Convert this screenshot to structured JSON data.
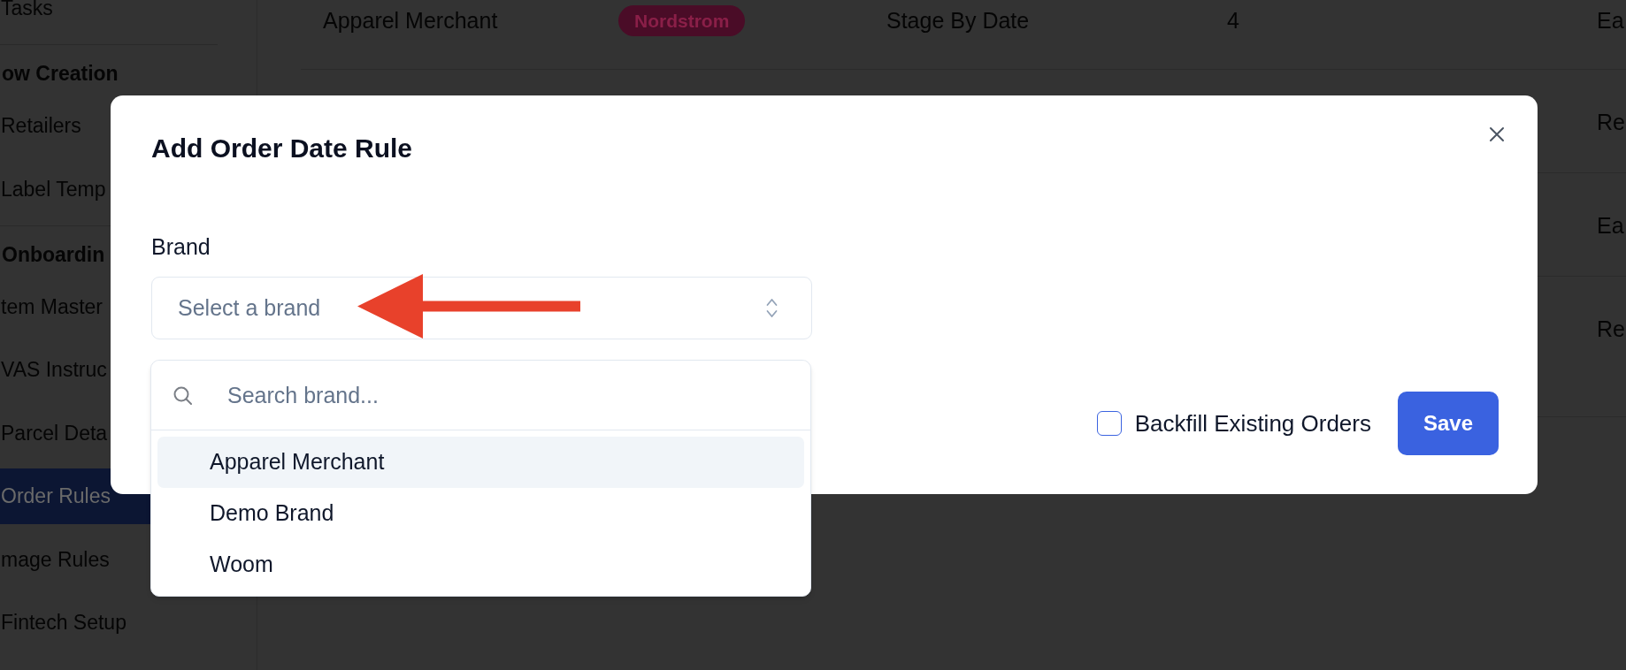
{
  "sidebar": {
    "sections": [
      {
        "items": [
          {
            "label": "Tasks",
            "selected": false
          }
        ]
      },
      {
        "title": "ow Creation",
        "items": [
          {
            "label": "Retailers",
            "selected": false
          },
          {
            "label": "Label Temp",
            "selected": false
          }
        ]
      },
      {
        "title": "Onboardin",
        "items": [
          {
            "label": "tem Master",
            "selected": false
          },
          {
            "label": "VAS Instruc",
            "selected": false
          },
          {
            "label": "Parcel Deta",
            "selected": false
          },
          {
            "label": "Order Rules",
            "selected": true
          },
          {
            "label": "mage Rules",
            "selected": false
          },
          {
            "label": "Fintech Setup",
            "selected": false
          }
        ]
      }
    ]
  },
  "table": {
    "rows": [
      {
        "column_1": "Apparel Merchant",
        "column_2": "Nordstrom",
        "column_3": "Stage By Date",
        "column_4": "4",
        "column_5": "Ea"
      },
      {
        "column_5": "Re"
      },
      {
        "column_5": "Ea"
      },
      {
        "column_5": "Re"
      }
    ]
  },
  "modal": {
    "title": "Add Order Date Rule",
    "brand_field": {
      "label": "Brand",
      "placeholder": "Select a brand",
      "expanded": true
    },
    "dropdown": {
      "search_placeholder": "Search brand...",
      "options": [
        {
          "label": "Apparel Merchant",
          "highlighted": true
        },
        {
          "label": "Demo Brand",
          "highlighted": false
        },
        {
          "label": "Woom",
          "highlighted": false
        }
      ]
    },
    "backfill_checkbox": {
      "label": "Backfill Existing Orders",
      "checked": false
    },
    "save_button": {
      "label": "Save"
    }
  }
}
